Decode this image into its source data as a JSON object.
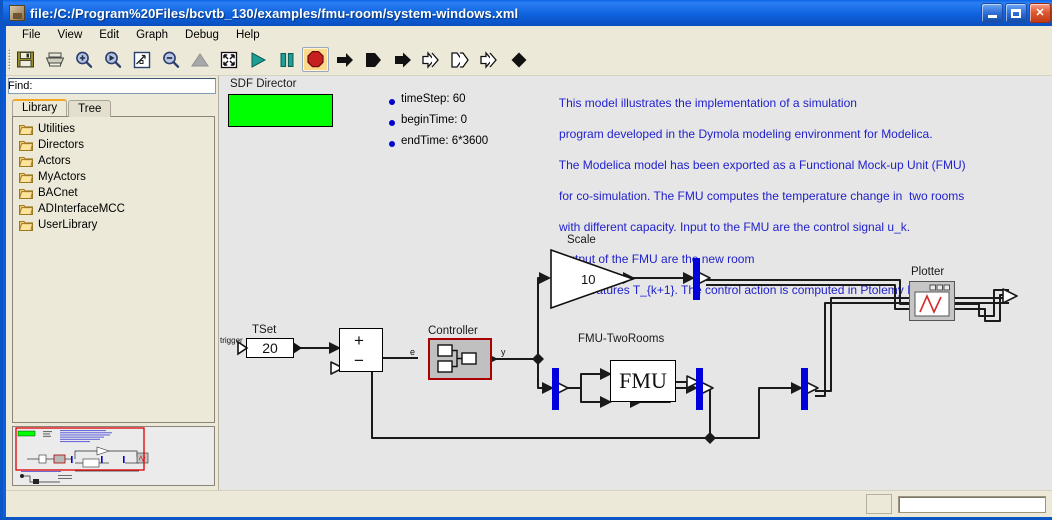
{
  "window": {
    "title": "file:/C:/Program%20Files/bcvtb_130/examples/fmu-room/system-windows.xml",
    "icon": "app-icon",
    "minimize_label": "Minimize",
    "maximize_label": "Maximize",
    "close_label": "Close"
  },
  "menubar": {
    "items": [
      {
        "label": "File"
      },
      {
        "label": "View"
      },
      {
        "label": "Edit"
      },
      {
        "label": "Graph"
      },
      {
        "label": "Debug"
      },
      {
        "label": "Help"
      }
    ]
  },
  "toolbar": {
    "buttons": [
      {
        "name": "save-icon",
        "label": "Save"
      },
      {
        "name": "print-icon",
        "label": "Print"
      },
      {
        "name": "zoom-in-icon",
        "label": "Zoom In"
      },
      {
        "name": "zoom-reset-icon",
        "label": "Zoom Reset"
      },
      {
        "name": "zoom-fit-icon",
        "label": "Zoom Fit"
      },
      {
        "name": "zoom-out-icon",
        "label": "Zoom Out"
      },
      {
        "name": "triangle-up-icon",
        "label": "Up"
      },
      {
        "name": "fullscreen-icon",
        "label": "Full Screen"
      },
      {
        "name": "run-icon",
        "label": "Run"
      },
      {
        "name": "pause-icon",
        "label": "Pause"
      },
      {
        "name": "stop-icon",
        "label": "Stop",
        "selected": true
      },
      {
        "name": "arrow-right-icon",
        "label": "Step"
      },
      {
        "name": "arrow-flag-icon",
        "label": "Run To"
      },
      {
        "name": "arrow-thick-icon",
        "label": "Continue"
      },
      {
        "name": "double-arrow-1-icon",
        "label": "Step Over"
      },
      {
        "name": "double-arrow-2-icon",
        "label": "Step Into"
      },
      {
        "name": "double-arrow-3-icon",
        "label": "Step Out"
      },
      {
        "name": "diamond-icon",
        "label": "Breakpoint"
      }
    ]
  },
  "sidebar": {
    "find_label": "Find:",
    "find_value": "",
    "find_placeholder": "",
    "tabs": [
      {
        "label": "Library",
        "active": true
      },
      {
        "label": "Tree",
        "active": false
      }
    ],
    "library_items": [
      {
        "label": "Utilities"
      },
      {
        "label": "Directors"
      },
      {
        "label": "Actors"
      },
      {
        "label": "MyActors"
      },
      {
        "label": "BACnet"
      },
      {
        "label": "ADInterfaceMCC"
      },
      {
        "label": "UserLibrary"
      }
    ],
    "thumbnail_name": "model-overview-thumbnail"
  },
  "canvas": {
    "director": {
      "label": "SDF Director",
      "color": "#00ff00"
    },
    "parameters": [
      {
        "label": "timeStep: 60"
      },
      {
        "label": "beginTime: 0"
      },
      {
        "label": "endTime: 6*3600"
      }
    ],
    "annotation": {
      "color": "#2222cc",
      "lines": [
        "This model illustrates the implementation of a simulation",
        "program developed in the Dymola modeling environment for Modelica.",
        "The Modelica model has been exported as a Functional Mock-up Unit (FMU)",
        "for co-simulation. The FMU computes the temperature change in  two rooms",
        "with different capacity. Input to the FMU are the control signal u_k.",
        "Output of the FMU are the new room",
        "temperatures T_{k+1}. The control action is computed in Ptolemy II."
      ]
    },
    "blocks": [
      {
        "name": "tset-block",
        "label": "TSet",
        "value": "20",
        "port_label": "trigger"
      },
      {
        "name": "adder-block",
        "label": "",
        "plus": "+",
        "minus": "−"
      },
      {
        "name": "controller-block",
        "label": "Controller",
        "output_port": "y",
        "input_port": "e",
        "fill": "#c0c0c0",
        "border": "#aa0000"
      },
      {
        "name": "scale-block",
        "label": "Scale",
        "value": "10"
      },
      {
        "name": "fmu-block",
        "label": "FMU-TwoRooms",
        "value": "FMU"
      },
      {
        "name": "plotter-block",
        "label": "Plotter"
      }
    ]
  },
  "statusbar": {
    "message": "",
    "progress_value": ""
  }
}
